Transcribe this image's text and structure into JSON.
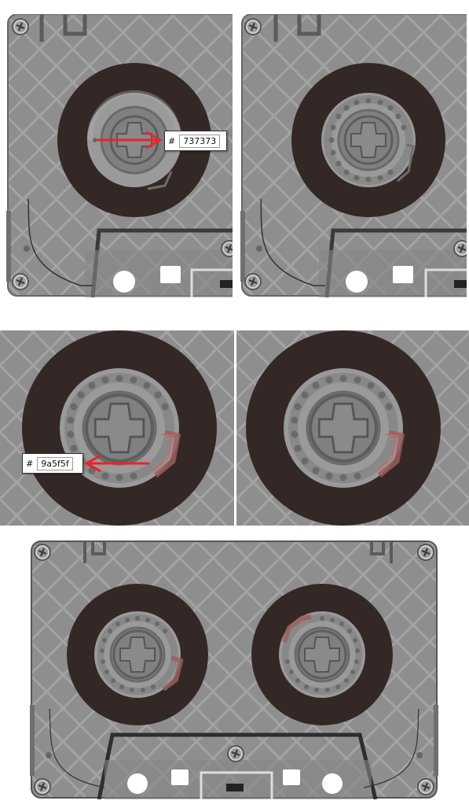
{
  "annotations": {
    "color_1": {
      "prefix": "#",
      "value": "737373"
    },
    "color_2": {
      "prefix": "#",
      "value": "9a5f5f"
    }
  },
  "colors": {
    "shell": "#8b8b8b",
    "shell_dark": "#6f6f6f",
    "tape": "#342826",
    "hub": "#737373",
    "hub_light": "#9a9a9a",
    "accent": "#9a5f5f",
    "arrow": "#e8242a"
  },
  "icons": [
    "screw-icon",
    "arrow-icon"
  ]
}
